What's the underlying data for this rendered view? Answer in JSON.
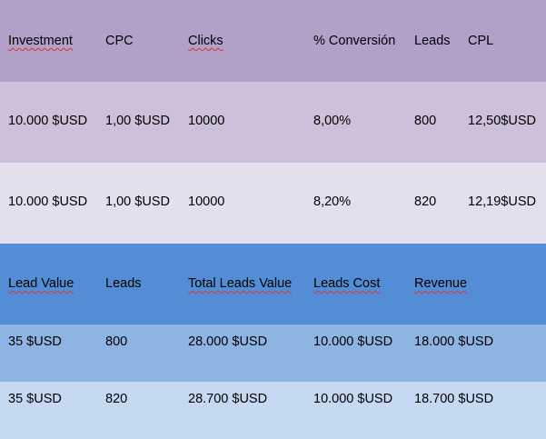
{
  "table1": {
    "headers": [
      "Investment",
      "CPC",
      "Clicks",
      "% Conversión",
      "Leads",
      "CPL"
    ],
    "rows": [
      [
        "10.000 $USD",
        "1,00 $USD",
        "10000",
        "8,00%",
        "800",
        "12,50$USD"
      ],
      [
        "10.000 $USD",
        "1,00 $USD",
        "10000",
        "8,20%",
        "820",
        "12,19$USD"
      ]
    ]
  },
  "table2": {
    "headers": [
      "Lead Value",
      "Leads",
      "Total Leads Value",
      "Leads Cost",
      "Revenue"
    ],
    "rows": [
      [
        "35 $USD",
        "800",
        "28.000 $USD",
        "10.000 $USD",
        "18.000 $USD"
      ],
      [
        "35 $USD",
        "820",
        "28.700 $USD",
        "10.000 $USD",
        "18.700 $USD"
      ]
    ]
  },
  "colors": {
    "table1_header": "#b1a0c7",
    "table1_row1": "#ccc0da",
    "table1_row2": "#e4dfec",
    "table2_header": "#538dd5",
    "table2_row1": "#8db4e2",
    "table2_row2": "#c5d9f1",
    "spellcheck_underline": "#e03030"
  }
}
